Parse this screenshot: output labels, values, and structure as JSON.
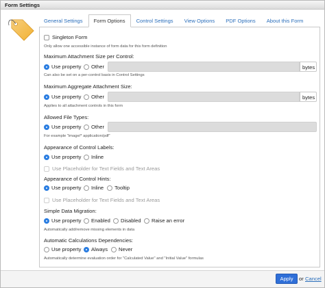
{
  "window": {
    "title": "Form Settings"
  },
  "tabs": [
    {
      "label": "General Settings"
    },
    {
      "label": "Form Options"
    },
    {
      "label": "Control Settings"
    },
    {
      "label": "View Options"
    },
    {
      "label": "PDF Options"
    },
    {
      "label": "About this Form"
    }
  ],
  "active_tab": "Form Options",
  "singleton": {
    "label": "Singleton Form",
    "help": "Only allow one accessible instance of form data for this form definition",
    "checked": false
  },
  "max_attachment": {
    "heading": "Maximum Attachment Size per Control:",
    "options": [
      "Use property",
      "Other"
    ],
    "selected": "Use property",
    "value": "",
    "unit": "bytes",
    "help": "Can also be set on a per-control basis in Control Settings"
  },
  "max_aggregate": {
    "heading": "Maximum Aggregate Attachment Size:",
    "options": [
      "Use property",
      "Other"
    ],
    "selected": "Use property",
    "value": "",
    "unit": "bytes",
    "help": "Applies to all attachment controls in this form"
  },
  "file_types": {
    "heading": "Allowed File Types:",
    "options": [
      "Use property",
      "Other"
    ],
    "selected": "Use property",
    "value": "",
    "help": "For example \"image/* application/pdf\""
  },
  "control_labels": {
    "heading": "Appearance of Control Labels:",
    "options": [
      "Use property",
      "Inline"
    ],
    "selected": "Use property",
    "placeholder_label": "Use Placeholder for Text Fields and Text Areas"
  },
  "control_hints": {
    "heading": "Appearance of Control Hints:",
    "options": [
      "Use property",
      "Inline",
      "Tooltip"
    ],
    "selected": "Use property",
    "placeholder_label": "Use Placeholder for Text Fields and Text Areas"
  },
  "data_migration": {
    "heading": "Simple Data Migration:",
    "options": [
      "Use property",
      "Enabled",
      "Disabled",
      "Raise an error"
    ],
    "selected": "Use property",
    "help": "Automatically add/remove missing elements in data"
  },
  "calc_deps": {
    "heading": "Automatic Calculations Dependencies:",
    "options": [
      "Use property",
      "Always",
      "Never"
    ],
    "selected": "Always",
    "help": "Automatically determine evaluation order for \"Calculated Value\" and \"Initial Value\" formulas"
  },
  "footer": {
    "apply": "Apply",
    "or": "or",
    "cancel": "Cancel"
  },
  "colors": {
    "accent": "#2a7de1",
    "link": "#2a6ebb",
    "apply_button": "#2f6fd8",
    "tag_icon": "#f2b233"
  }
}
